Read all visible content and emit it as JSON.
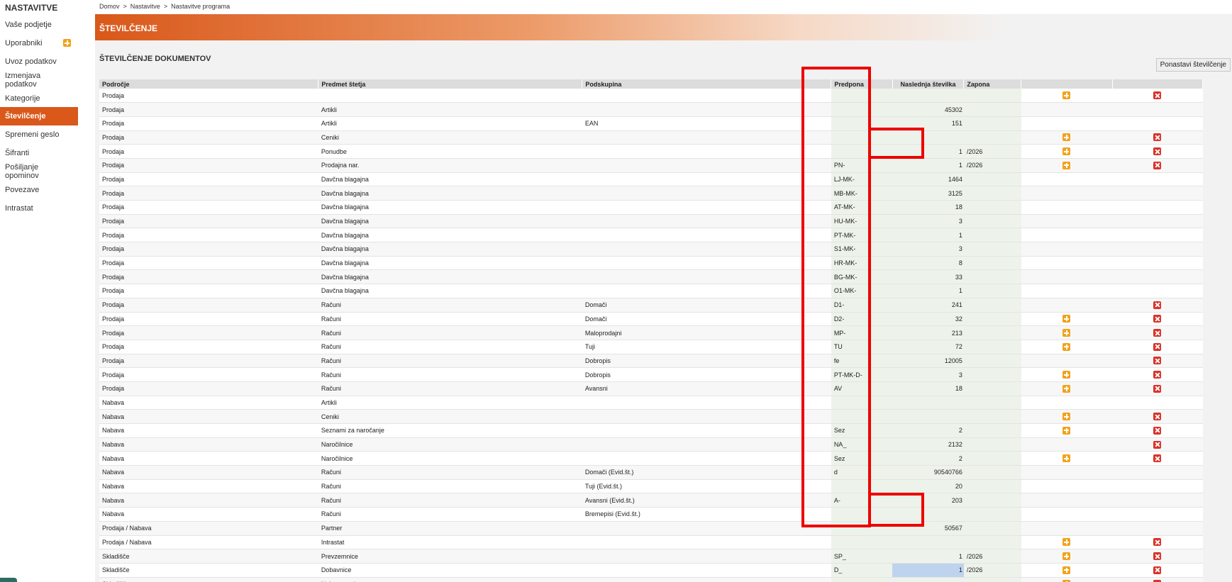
{
  "sidebar": {
    "title": "NASTAVITVE",
    "items": [
      {
        "label": "Vaše podjetje",
        "add": false,
        "active": false
      },
      {
        "label": "Uporabniki",
        "add": true,
        "active": false
      },
      {
        "label": "Uvoz podatkov",
        "add": false,
        "active": false
      },
      {
        "label": "Izmenjava podatkov",
        "add": false,
        "active": false
      },
      {
        "label": "Kategorije",
        "add": false,
        "active": false
      },
      {
        "label": "Številčenje",
        "add": false,
        "active": true
      },
      {
        "label": "Spremeni geslo",
        "add": false,
        "active": false
      },
      {
        "label": "Šifranti",
        "add": false,
        "active": false
      },
      {
        "label": "Pošiljanje opominov",
        "add": false,
        "active": false
      },
      {
        "label": "Povezave",
        "add": false,
        "active": false
      },
      {
        "label": "Intrastat",
        "add": false,
        "active": false
      }
    ]
  },
  "breadcrumb": [
    "Domov",
    "Nastavitve",
    "Nastavitve programa"
  ],
  "banner": {
    "title": "ŠTEVILČENJE"
  },
  "section": {
    "title": "ŠTEVILČENJE DOKUMENTOV"
  },
  "reset_button": "Ponastavi številčenje",
  "colors": {
    "accent": "#d9581a",
    "plus_icon": "#f2a21b",
    "delete_icon": "#d9322a",
    "highlight_box": "#ee0000"
  },
  "icons": {
    "add": "plus-icon",
    "delete": "x-icon"
  },
  "table": {
    "columns": [
      "Področje",
      "Predmet štetja",
      "Podskupina",
      "Predpona",
      "Naslednja številka",
      "Zapona",
      "",
      ""
    ],
    "rows": [
      {
        "area": "Prodaja",
        "subject": "",
        "subgroup": "",
        "prefix": "",
        "next": "",
        "suffix": "",
        "add": true,
        "del": true
      },
      {
        "area": "Prodaja",
        "subject": "Artikli",
        "subgroup": "",
        "prefix": "",
        "next": "45302",
        "suffix": "",
        "add": false,
        "del": false
      },
      {
        "area": "Prodaja",
        "subject": "Artikli",
        "subgroup": "EAN",
        "prefix": "",
        "next": "151",
        "suffix": "",
        "add": false,
        "del": false
      },
      {
        "area": "Prodaja",
        "subject": "Ceniki",
        "subgroup": "",
        "prefix": "",
        "next": "",
        "suffix": "",
        "add": true,
        "del": true
      },
      {
        "area": "Prodaja",
        "subject": "Ponudbe",
        "subgroup": "",
        "prefix": "",
        "next": "1",
        "suffix": "/2026",
        "add": true,
        "del": true
      },
      {
        "area": "Prodaja",
        "subject": "Prodajna nar.",
        "subgroup": "",
        "prefix": "PN-",
        "next": "1",
        "suffix": "/2026",
        "add": true,
        "del": true
      },
      {
        "area": "Prodaja",
        "subject": "Davčna blagajna",
        "subgroup": "",
        "prefix": "LJ-MK-",
        "next": "1464",
        "suffix": "",
        "add": false,
        "del": false
      },
      {
        "area": "Prodaja",
        "subject": "Davčna blagajna",
        "subgroup": "",
        "prefix": "MB-MK-",
        "next": "3125",
        "suffix": "",
        "add": false,
        "del": false
      },
      {
        "area": "Prodaja",
        "subject": "Davčna blagajna",
        "subgroup": "",
        "prefix": "AT-MK-",
        "next": "18",
        "suffix": "",
        "add": false,
        "del": false
      },
      {
        "area": "Prodaja",
        "subject": "Davčna blagajna",
        "subgroup": "",
        "prefix": "HU-MK-",
        "next": "3",
        "suffix": "",
        "add": false,
        "del": false
      },
      {
        "area": "Prodaja",
        "subject": "Davčna blagajna",
        "subgroup": "",
        "prefix": "PT-MK-",
        "next": "1",
        "suffix": "",
        "add": false,
        "del": false
      },
      {
        "area": "Prodaja",
        "subject": "Davčna blagajna",
        "subgroup": "",
        "prefix": "S1-MK-",
        "next": "3",
        "suffix": "",
        "add": false,
        "del": false
      },
      {
        "area": "Prodaja",
        "subject": "Davčna blagajna",
        "subgroup": "",
        "prefix": "HR-MK-",
        "next": "8",
        "suffix": "",
        "add": false,
        "del": false
      },
      {
        "area": "Prodaja",
        "subject": "Davčna blagajna",
        "subgroup": "",
        "prefix": "BG-MK-",
        "next": "33",
        "suffix": "",
        "add": false,
        "del": false
      },
      {
        "area": "Prodaja",
        "subject": "Davčna blagajna",
        "subgroup": "",
        "prefix": "O1-MK-",
        "next": "1",
        "suffix": "",
        "add": false,
        "del": false
      },
      {
        "area": "Prodaja",
        "subject": "Računi",
        "subgroup": "Domači",
        "prefix": "D1-",
        "next": "241",
        "suffix": "",
        "add": false,
        "del": true
      },
      {
        "area": "Prodaja",
        "subject": "Računi",
        "subgroup": "Domači",
        "prefix": "D2-",
        "next": "32",
        "suffix": "",
        "add": true,
        "del": true
      },
      {
        "area": "Prodaja",
        "subject": "Računi",
        "subgroup": "Maloprodajni",
        "prefix": "MP-",
        "next": "213",
        "suffix": "",
        "add": true,
        "del": true
      },
      {
        "area": "Prodaja",
        "subject": "Računi",
        "subgroup": "Tuji",
        "prefix": "TU",
        "next": "72",
        "suffix": "",
        "add": true,
        "del": true
      },
      {
        "area": "Prodaja",
        "subject": "Računi",
        "subgroup": "Dobropis",
        "prefix": "fe",
        "next": "12005",
        "suffix": "",
        "add": false,
        "del": true
      },
      {
        "area": "Prodaja",
        "subject": "Računi",
        "subgroup": "Dobropis",
        "prefix": "PT-MK-D-",
        "next": "3",
        "suffix": "",
        "add": true,
        "del": true
      },
      {
        "area": "Prodaja",
        "subject": "Računi",
        "subgroup": "Avansni",
        "prefix": "AV",
        "next": "18",
        "suffix": "",
        "add": true,
        "del": true
      },
      {
        "area": "Nabava",
        "subject": "Artikli",
        "subgroup": "",
        "prefix": "",
        "next": "",
        "suffix": "",
        "add": false,
        "del": false
      },
      {
        "area": "Nabava",
        "subject": "Ceniki",
        "subgroup": "",
        "prefix": "",
        "next": "",
        "suffix": "",
        "add": true,
        "del": true
      },
      {
        "area": "Nabava",
        "subject": "Seznami za naročanje",
        "subgroup": "",
        "prefix": "Sez",
        "next": "2",
        "suffix": "",
        "add": true,
        "del": true
      },
      {
        "area": "Nabava",
        "subject": "Naročilnice",
        "subgroup": "",
        "prefix": "NA_",
        "next": "2132",
        "suffix": "",
        "add": false,
        "del": true
      },
      {
        "area": "Nabava",
        "subject": "Naročilnice",
        "subgroup": "",
        "prefix": "Sez",
        "next": "2",
        "suffix": "",
        "add": true,
        "del": true
      },
      {
        "area": "Nabava",
        "subject": "Računi",
        "subgroup": "Domači (Evid.št.)",
        "prefix": "d",
        "next": "90540766",
        "suffix": "",
        "add": false,
        "del": false
      },
      {
        "area": "Nabava",
        "subject": "Računi",
        "subgroup": "Tuji (Evid.št.)",
        "prefix": "",
        "next": "20",
        "suffix": "",
        "add": false,
        "del": false
      },
      {
        "area": "Nabava",
        "subject": "Računi",
        "subgroup": "Avansni (Evid.št.)",
        "prefix": "A-",
        "next": "203",
        "suffix": "",
        "add": false,
        "del": false
      },
      {
        "area": "Nabava",
        "subject": "Računi",
        "subgroup": "Bremepisi (Evid.št.)",
        "prefix": "",
        "next": "",
        "suffix": "",
        "add": false,
        "del": false
      },
      {
        "area": "Prodaja / Nabava",
        "subject": "Partner",
        "subgroup": "",
        "prefix": "",
        "next": "50567",
        "suffix": "",
        "add": false,
        "del": false
      },
      {
        "area": "Prodaja / Nabava",
        "subject": "Intrastat",
        "subgroup": "",
        "prefix": "",
        "next": "",
        "suffix": "",
        "add": true,
        "del": true
      },
      {
        "area": "Skladišče",
        "subject": "Prevzemnice",
        "subgroup": "",
        "prefix": "SP_",
        "next": "1",
        "suffix": "/2026",
        "add": true,
        "del": true
      },
      {
        "area": "Skladišče",
        "subject": "Dobavnice",
        "subgroup": "",
        "prefix": "D_",
        "next": "1",
        "suffix": "/2026",
        "add": true,
        "del": true,
        "selected": true
      },
      {
        "area": "Skladišče",
        "subject": "Nalog za odpremo",
        "subgroup": "",
        "prefix": "",
        "next": "",
        "suffix": "",
        "add": true,
        "del": true
      }
    ]
  }
}
